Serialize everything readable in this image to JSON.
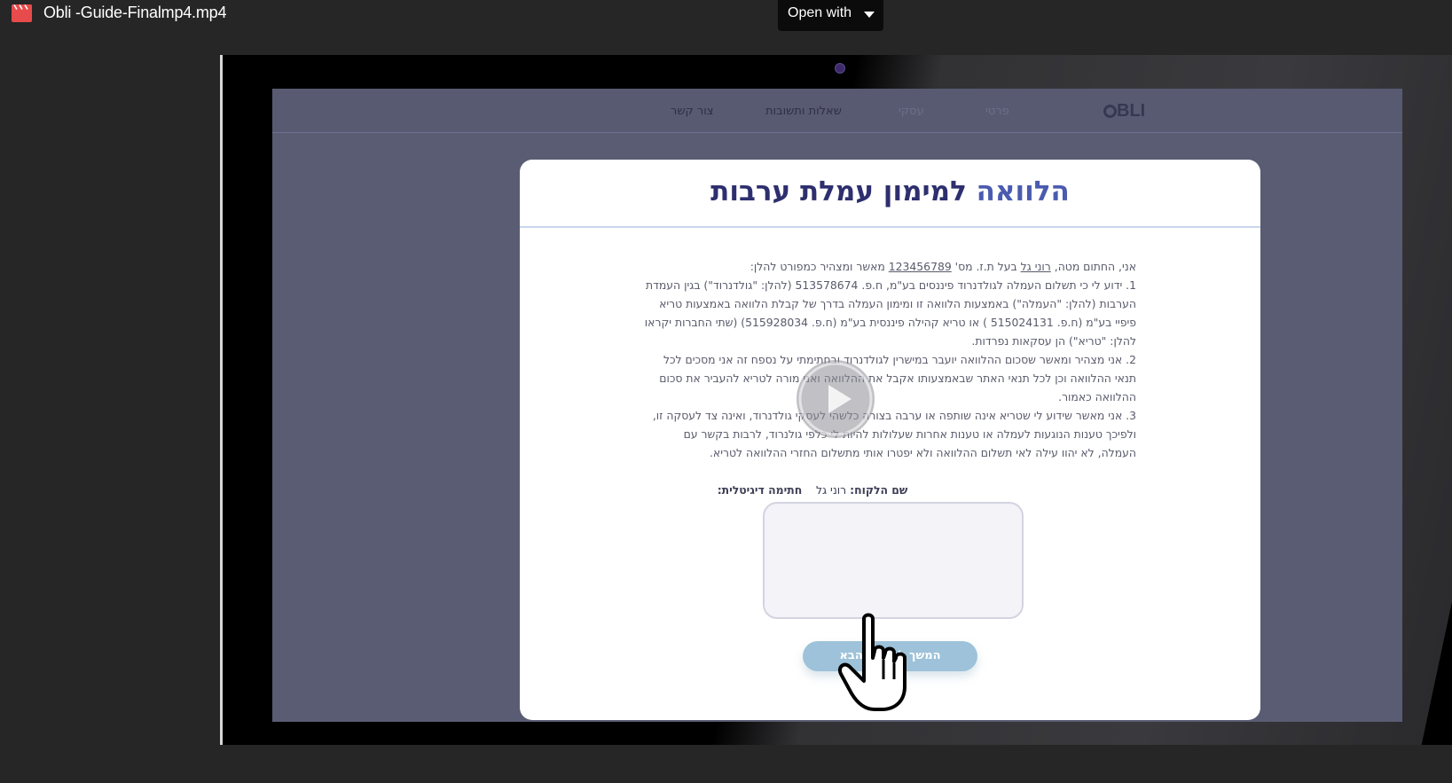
{
  "topbar": {
    "file_name": "Obli -Guide-Finalmp4.mp4",
    "open_with_label": "Open with",
    "file_icon": "video-file-icon"
  },
  "video": {
    "site_nav": {
      "items": [
        "צור קשר",
        "שאלות ותשובות",
        "עסקי",
        "פרטי"
      ],
      "logo": "BLI"
    },
    "modal": {
      "title_part1": "הלוואה",
      "title_part2": " למימון עמלת ערבות",
      "terms": {
        "intro_pre": "אני, החתום מטה, ",
        "intro_name": "רוני גל",
        "intro_mid": " בעל ת.ז. מס' ",
        "intro_id": "123456789",
        "intro_post": " מאשר ומצהיר כמפורט להלן:",
        "p1": "1. ידוע לי כי תשלום העמלה לגולדנרוד פיננסים בע\"מ, ח.פ. 513578674 (להלן: \"גולדנרוד\") בגין העמדת הערבות (להלן: \"העמלה\") באמצעות הלוואה זו ומימון העמלה בדרך של קבלת הלוואה באמצעות טריא פיפיי בע\"מ (ח.פ. 515024131 ) או טריא קהילה פיננסית בע\"מ (ח.פ. 515928034) (שתי החברות יקראו להלן: \"טריא\") הן עסקאות נפרדות.",
        "p2": "2. אני מצהיר ומאשר שסכום ההלוואה יועבר במישרין לגולדנרוד ובחתימתי על נספח זה אני מסכים לכל תנאי ההלוואה וכן לכל תנאי האתר שבאמצעותו אקבל את ההלוואה ואני מורה לטריא להעביר את סכום ההלוואה כאמור.",
        "p3": "3. אני מאשר שידוע לי שטריא אינה שותפה או ערבה בצורה כלשהי לעסקי גולדנרוד, ואינה צד לעסקה זו, ולפיכך טענות הנוגעות לעמלה או טענות אחרות שעלולות להיות לי כלפי גולנרוד, לרבות בקשר עם העמלה, לא יהוו עילה לאי תשלום ההלוואה ולא יפטרו אותי מתשלום החזרי ההלוואה לטריא."
      },
      "customer_name_label": "שם הלקוח:",
      "customer_name_value": " רוני גל",
      "digital_signature_label": "חתימה דיגיטלית:",
      "next_button": "המשך למסמך הבא"
    },
    "overlay_icons": [
      "play-icon",
      "hand-pointer-icon",
      "camera-dot-icon"
    ]
  }
}
